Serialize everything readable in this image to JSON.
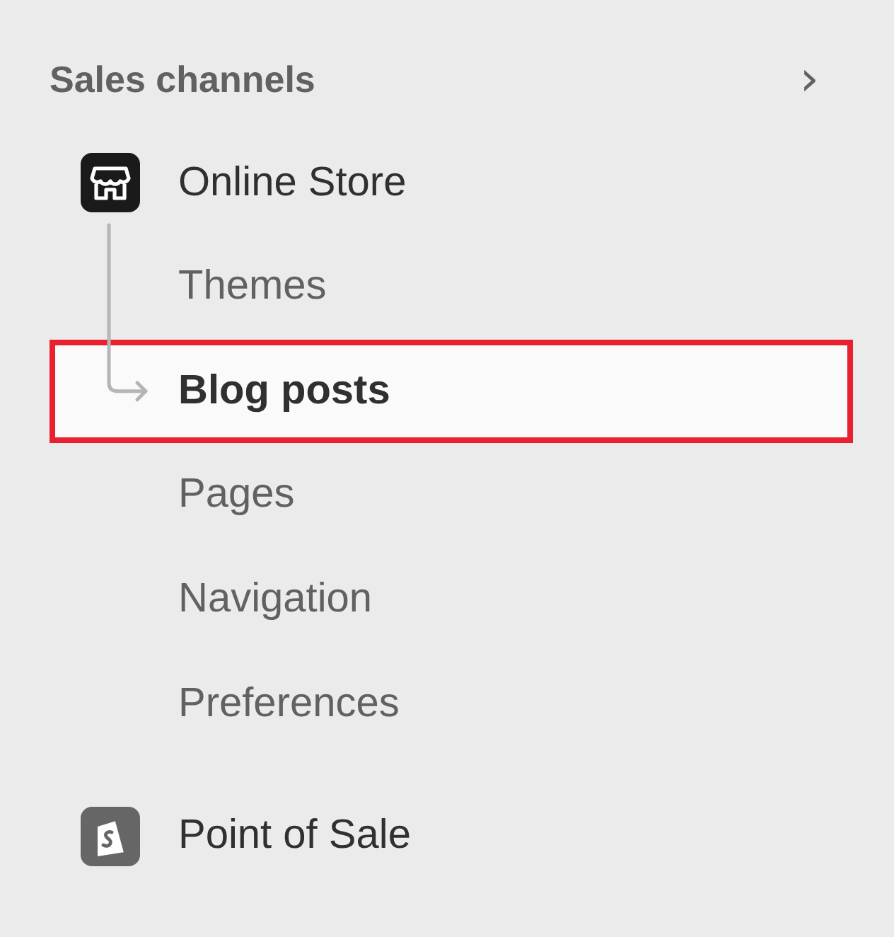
{
  "section": {
    "title": "Sales channels",
    "chevron": "›"
  },
  "channels": [
    {
      "label": "Online Store",
      "children": [
        {
          "label": "Themes",
          "selected": false
        },
        {
          "label": "Blog posts",
          "selected": true
        },
        {
          "label": "Pages",
          "selected": false
        },
        {
          "label": "Navigation",
          "selected": false
        },
        {
          "label": "Preferences",
          "selected": false
        }
      ]
    },
    {
      "label": "Point of Sale"
    }
  ]
}
